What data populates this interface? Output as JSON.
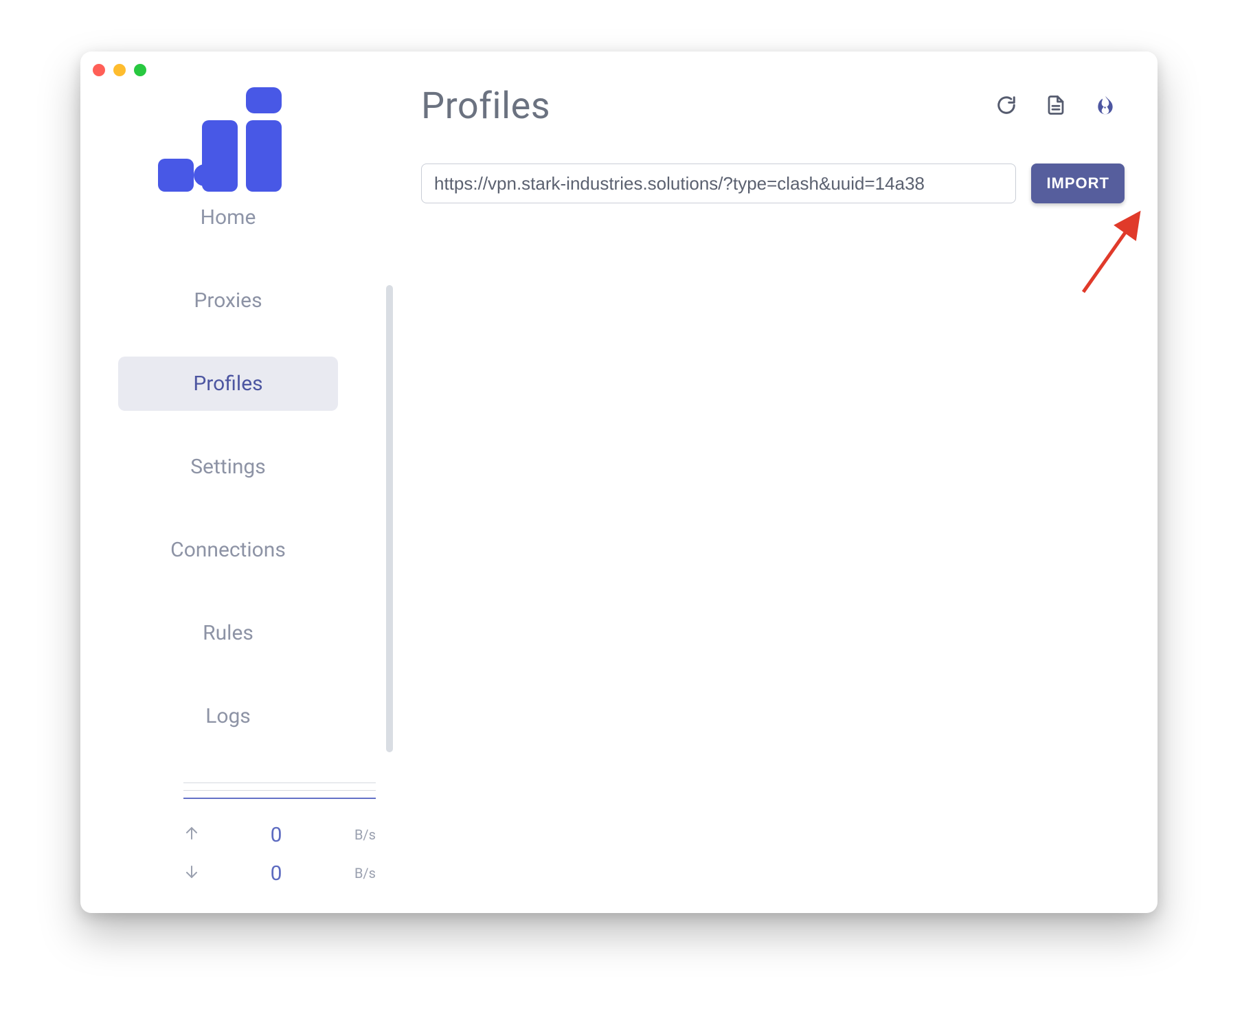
{
  "colors": {
    "accent": "#565e9d",
    "logo": "#4858e6",
    "text_muted": "#8d93a5"
  },
  "sidebar": {
    "items": [
      {
        "label": "Home"
      },
      {
        "label": "Proxies"
      },
      {
        "label": "Profiles"
      },
      {
        "label": "Settings"
      },
      {
        "label": "Connections"
      },
      {
        "label": "Rules"
      },
      {
        "label": "Logs"
      }
    ],
    "active_index": 2
  },
  "stats": {
    "upload": {
      "value": "0",
      "unit": "B/s"
    },
    "download": {
      "value": "0",
      "unit": "B/s"
    }
  },
  "header": {
    "title": "Profiles"
  },
  "url_bar": {
    "value": "https://vpn.stark-industries.solutions/?type=clash&uuid=14a38",
    "import_label": "IMPORT"
  }
}
